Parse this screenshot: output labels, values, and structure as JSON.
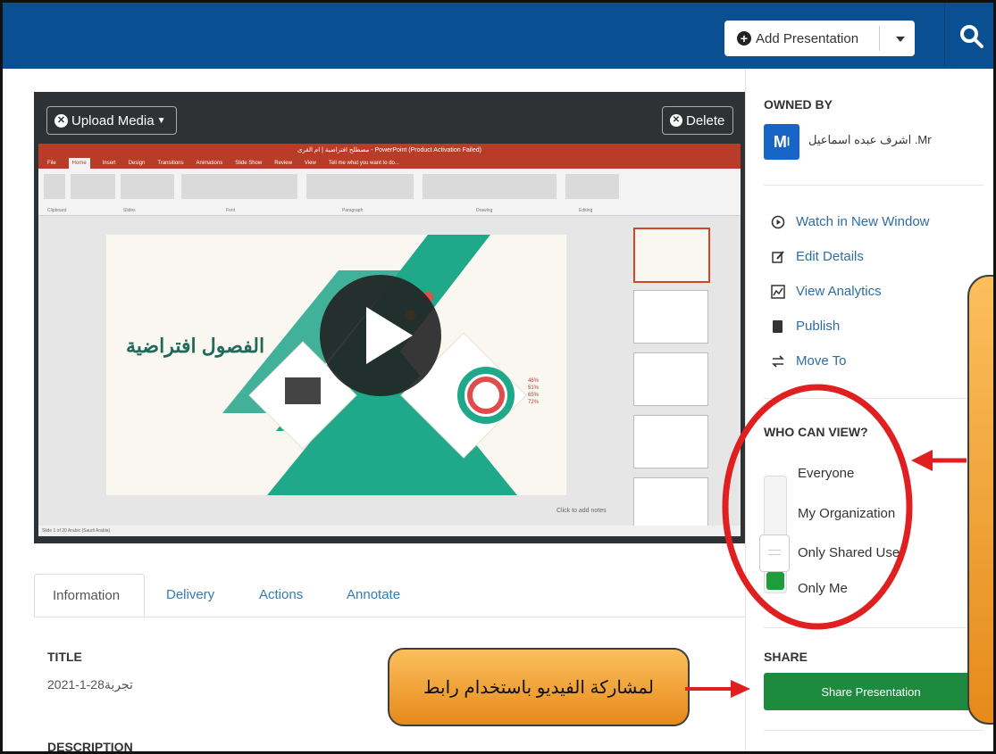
{
  "header": {
    "add_presentation_label": "Add Presentation"
  },
  "player": {
    "upload_label": "Upload Media",
    "delete_label": "Delete",
    "ppt": {
      "window_title": "مصطلح افتراضية | ام القرى - PowerPoint (Product Activation Failed)",
      "tabs": [
        "File",
        "Home",
        "Insert",
        "Design",
        "Transitions",
        "Animations",
        "Slide Show",
        "Review",
        "View",
        "Tell me what you want to do..."
      ],
      "ribbon_groups": [
        "Clipboard",
        "Slides",
        "Font",
        "Paragraph",
        "Drawing",
        "Editing"
      ],
      "slide_title": "الفصول افتراضية",
      "notes_placeholder": "Click to add notes",
      "status": "Slide 1 of 20   Arabic (Saudi Arabia)",
      "percentages": [
        "46%",
        "51%",
        "65%",
        "72%"
      ]
    }
  },
  "tabs": [
    "Information",
    "Delivery",
    "Actions",
    "Annotate"
  ],
  "info": {
    "title_label": "TITLE",
    "title_value": "تجربة28-1-2021",
    "description_label": "DESCRIPTION"
  },
  "sidebar": {
    "owned_by_label": "OWNED BY",
    "avatar_initials": "M",
    "owner_name": "اشرف عبده اسماعيل .Mr",
    "actions": [
      "Watch in New Window",
      "Edit Details",
      "View Analytics",
      "Publish",
      "Move To"
    ],
    "who_can_view_label": "WHO CAN VIEW?",
    "view_options": [
      "Everyone",
      "My Organization",
      "Only Shared Use",
      "Only Me"
    ],
    "view_selected": "Only Me",
    "share_label": "SHARE",
    "share_button": "Share Presentation"
  },
  "callout": {
    "text": "لمشاركة الفيديو باستخدام رابط"
  },
  "colors": {
    "header": "#0b4f93",
    "accent_green": "#1e8a3e",
    "callout_orange": "#f5a43a",
    "annotation_red": "#e02020"
  }
}
